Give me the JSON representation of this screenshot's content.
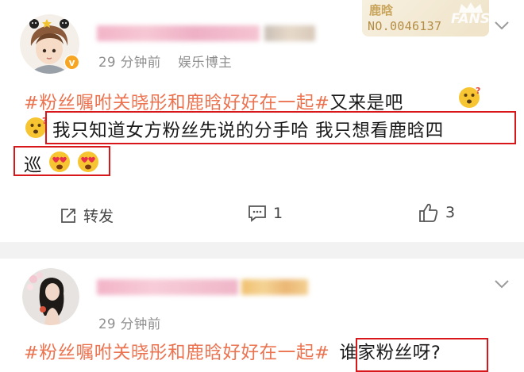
{
  "post1": {
    "timestamp": "29 分钟前",
    "role": "娱乐博主",
    "topic": "#粉丝嘱咐关晓彤和鹿晗好好在一起#",
    "text_after_topic": "又来是吧",
    "line2": "我只知道女方粉丝先说的分手哈 我只想看鹿晗四",
    "line3": "巡",
    "badge": {
      "name": "鹿晗",
      "number": "NO.0046137",
      "fans": "FANS"
    },
    "actions": {
      "repost_label": "转发",
      "comment_count": "1",
      "like_count": "3"
    }
  },
  "post2": {
    "timestamp": "29 分钟前",
    "topic": "#粉丝嘱咐关晓彤和鹿晗好好在一起#",
    "text_after_topic": "谁家粉丝呀?"
  },
  "colors": {
    "topic": "#eb7350",
    "highlight_box": "#d8171b",
    "meta_text": "#8e8e8e",
    "separator": "#f2f2f2"
  },
  "icons": [
    "verified-badge-icon",
    "crown-icon",
    "chevron-down-icon",
    "repost-icon",
    "comment-icon",
    "like-icon",
    "thinking-face-icon",
    "heart-eyes-face-icon"
  ]
}
